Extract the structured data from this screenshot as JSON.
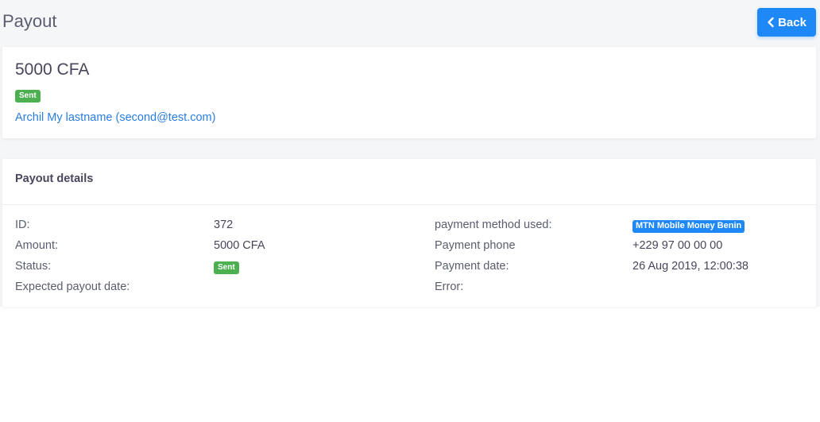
{
  "header": {
    "title": "Payout",
    "back_label": "Back"
  },
  "summary": {
    "amount": "5000 CFA",
    "status_badge": "Sent",
    "user_link": "Archil My lastname (second@test.com)"
  },
  "details": {
    "title": "Payout details",
    "left": [
      {
        "label": "ID:",
        "value": "372"
      },
      {
        "label": "Amount:",
        "value": "5000 CFA"
      },
      {
        "label": "Status:",
        "value": "Sent"
      },
      {
        "label": "Expected payout date:",
        "value": ""
      }
    ],
    "right": [
      {
        "label": "payment method used:",
        "value": "MTN Mobile Money Benin"
      },
      {
        "label": "Payment phone",
        "value": "+229 97 00 00 00"
      },
      {
        "label": "Payment date:",
        "value": "26 Aug 2019, 12:00:38"
      },
      {
        "label": "Error:",
        "value": ""
      }
    ]
  },
  "colors": {
    "accent": "#1e88f7",
    "success": "#4caf50",
    "link": "#2a7de0"
  }
}
